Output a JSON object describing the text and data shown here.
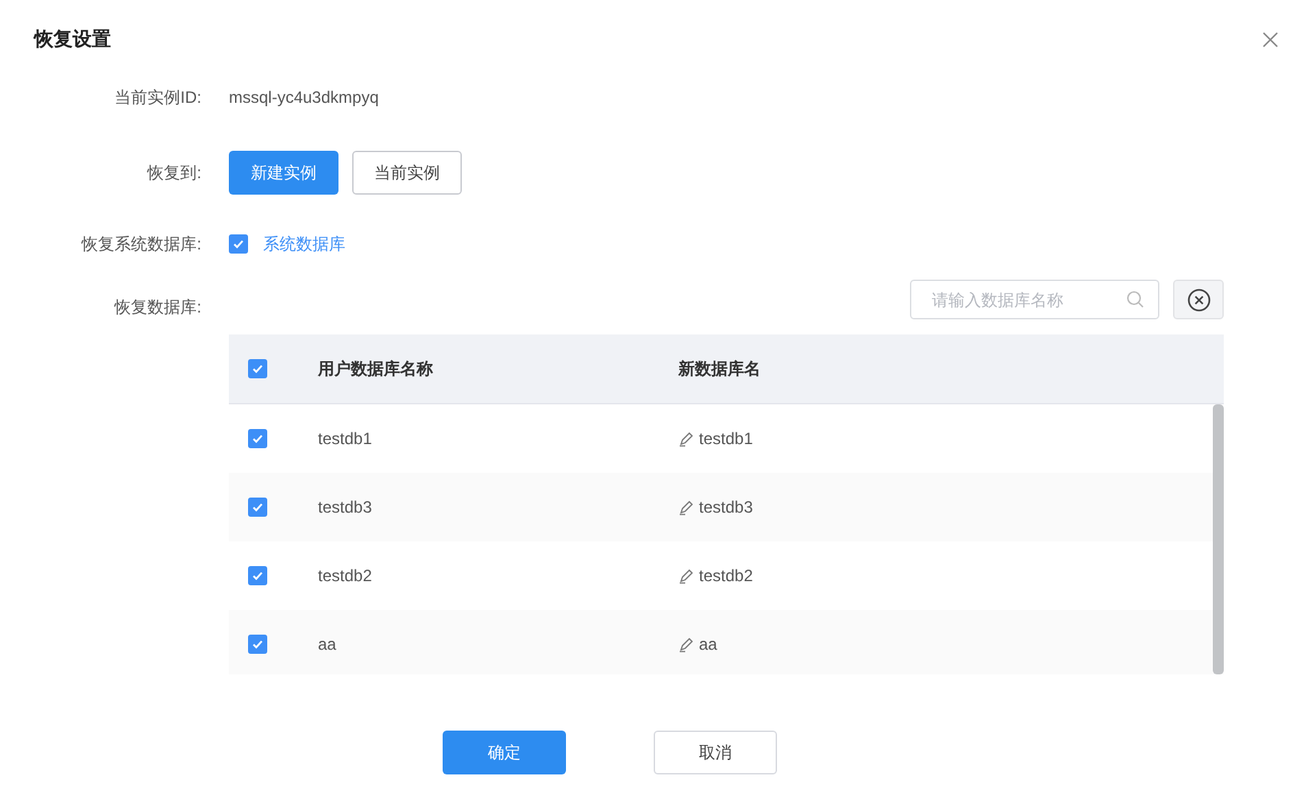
{
  "dialog": {
    "title": "恢复设置"
  },
  "fields": [
    {
      "kind": "text",
      "label": "当前实例ID:",
      "value": "mssql-yc4u3dkmpyq"
    },
    {
      "kind": "choice",
      "label": "恢复到:",
      "options": [
        {
          "label": "新建实例",
          "selected": true
        },
        {
          "label": "当前实例",
          "selected": false
        }
      ]
    },
    {
      "kind": "checkbox",
      "label": "恢复系统数据库:",
      "checked": true,
      "text": "系统数据库"
    },
    {
      "kind": "table",
      "label": "恢复数据库:"
    }
  ],
  "search": {
    "placeholder": "请输入数据库名称"
  },
  "table": {
    "all_checked": true,
    "columns": [
      "用户数据库名称",
      "新数据库名"
    ],
    "rows": [
      {
        "checked": true,
        "name": "testdb1",
        "new_name": "testdb1"
      },
      {
        "checked": true,
        "name": "testdb3",
        "new_name": "testdb3"
      },
      {
        "checked": true,
        "name": "testdb2",
        "new_name": "testdb2"
      },
      {
        "checked": true,
        "name": "aa",
        "new_name": "aa"
      }
    ]
  },
  "buttons": [
    {
      "label": "确定",
      "kind": "primary"
    },
    {
      "label": "取消",
      "kind": "default"
    }
  ]
}
